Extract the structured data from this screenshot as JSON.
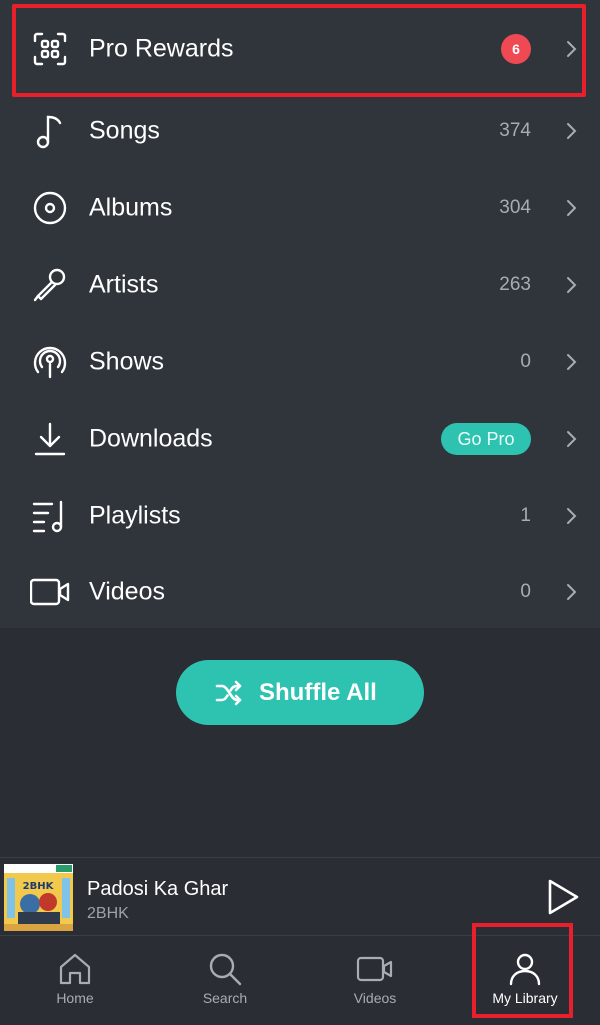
{
  "colors": {
    "background": "#2a2d33",
    "list_bg": "#30343b",
    "accent": "#2dc3b0",
    "badge": "#ef4a54",
    "highlight": "#e8202b"
  },
  "library": {
    "items": [
      {
        "label": "Pro Rewards",
        "icon": "rewards-grid-icon",
        "badge": "6"
      },
      {
        "label": "Songs",
        "icon": "music-note-icon",
        "count": "374"
      },
      {
        "label": "Albums",
        "icon": "disc-icon",
        "count": "304"
      },
      {
        "label": "Artists",
        "icon": "microphone-icon",
        "count": "263"
      },
      {
        "label": "Shows",
        "icon": "podcast-icon",
        "count": "0"
      },
      {
        "label": "Downloads",
        "icon": "download-icon",
        "pill": "Go Pro"
      },
      {
        "label": "Playlists",
        "icon": "playlist-icon",
        "count": "1"
      },
      {
        "label": "Videos",
        "icon": "video-camera-icon",
        "count": "0"
      }
    ]
  },
  "shuffle": {
    "label": "Shuffle All",
    "icon": "shuffle-icon"
  },
  "now_playing": {
    "title": "Padosi Ka Ghar",
    "artist": "2BHK",
    "art_text": "2BHK",
    "control_icon": "play-icon"
  },
  "bottom_nav": {
    "tabs": [
      {
        "label": "Home",
        "icon": "home-icon"
      },
      {
        "label": "Search",
        "icon": "search-icon"
      },
      {
        "label": "Videos",
        "icon": "video-camera-icon"
      },
      {
        "label": "My Library",
        "icon": "user-icon",
        "active": true
      }
    ]
  }
}
